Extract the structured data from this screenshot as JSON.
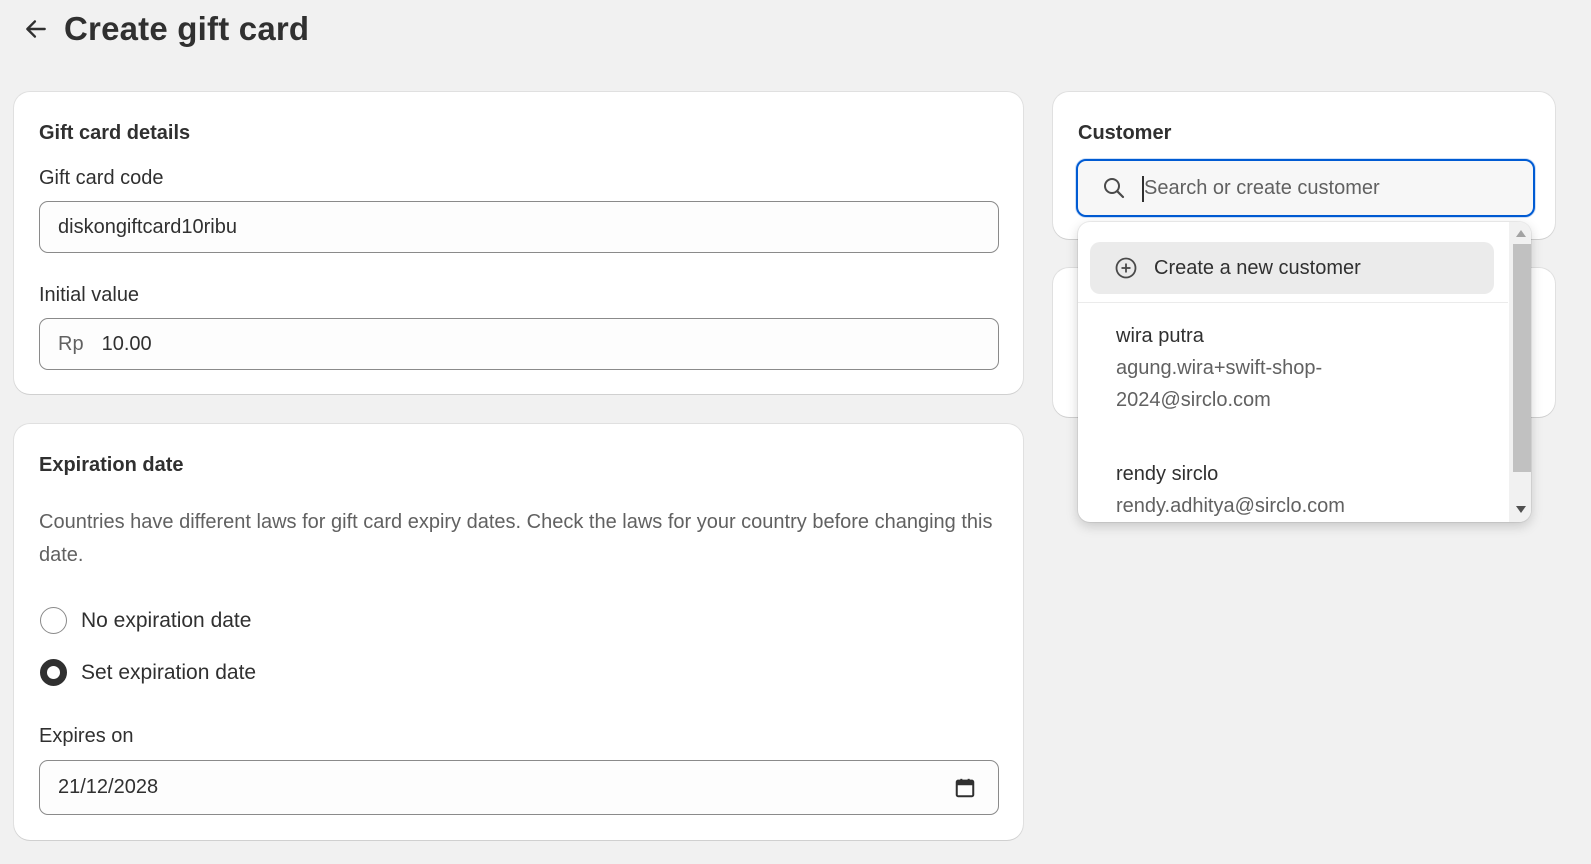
{
  "header": {
    "title": "Create gift card"
  },
  "details": {
    "title": "Gift card details",
    "code_label": "Gift card code",
    "code_value": "diskongiftcard10ribu",
    "value_label": "Initial value",
    "currency_prefix": "Rp",
    "value": "10.00"
  },
  "expiration": {
    "title": "Expiration date",
    "description": "Countries have different laws for gift card expiry dates. Check the laws for your country before changing this date.",
    "options": [
      {
        "label": "No expiration date",
        "checked": false
      },
      {
        "label": "Set expiration date",
        "checked": true
      }
    ],
    "expires_label": "Expires on",
    "expires_value": "21/12/2028"
  },
  "customer": {
    "title": "Customer",
    "search_placeholder": "Search or create customer",
    "create_label": "Create a new customer",
    "results": [
      {
        "name": "wira putra",
        "email_line1": "agung.wira+swift-shop-",
        "email_line2": "2024@sirclo.com"
      },
      {
        "name": "rendy sirclo",
        "email_line1": "rendy.adhitya@sirclo.com"
      }
    ]
  },
  "colors": {
    "focus": "#005bd3",
    "text": "#303030",
    "muted": "#616161",
    "background": "#f1f1f1"
  },
  "icons": {
    "back": "arrow-left-icon",
    "search": "search-icon",
    "create": "plus-circle-icon",
    "calendar": "calendar-icon"
  }
}
